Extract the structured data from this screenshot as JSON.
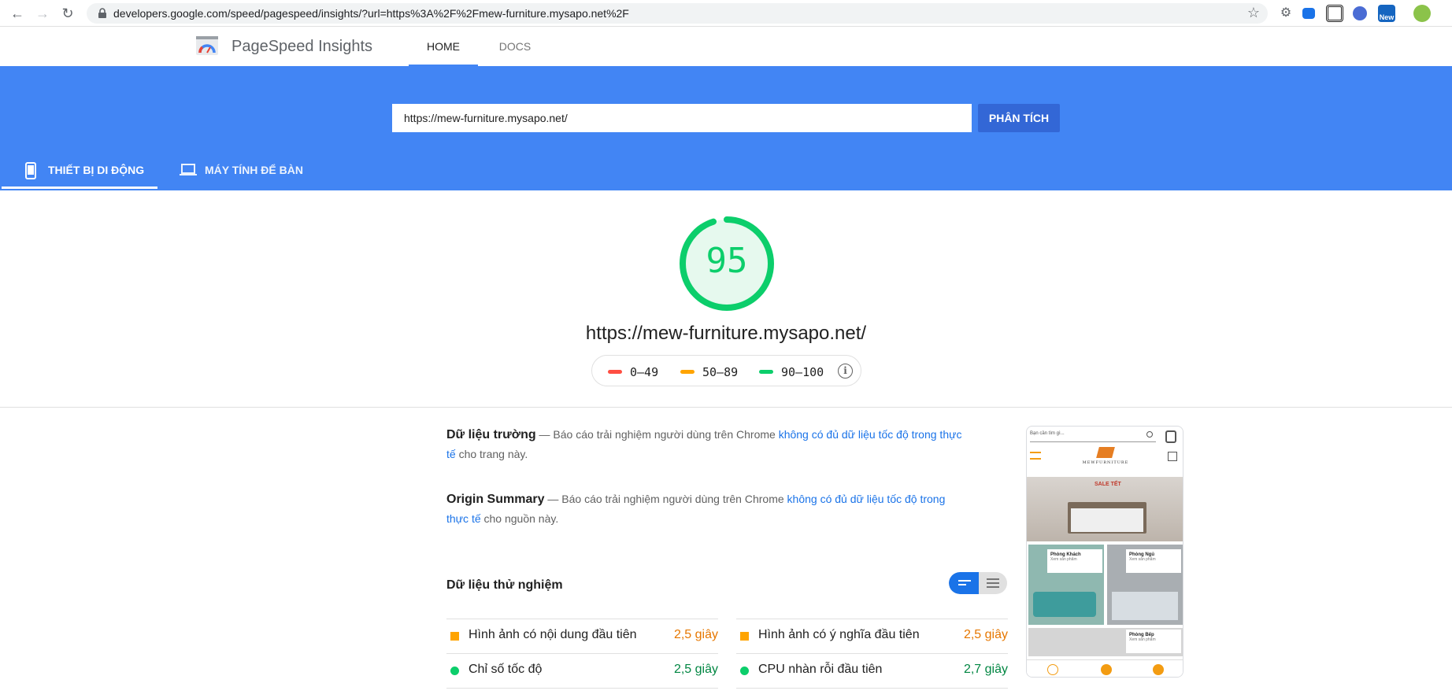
{
  "browser": {
    "url": "developers.google.com/speed/pagespeed/insights/?url=https%3A%2F%2Fmew-furniture.mysapo.net%2F",
    "extension_badge": "New"
  },
  "header": {
    "title": "PageSpeed Insights",
    "tabs": [
      {
        "label": "HOME"
      },
      {
        "label": "DOCS"
      }
    ]
  },
  "search": {
    "value": "https://mew-furniture.mysapo.net/",
    "button": "PHÂN TÍCH"
  },
  "device_tabs": [
    {
      "label": "THIẾT BỊ DI ĐỘNG",
      "active": true
    },
    {
      "label": "MÁY TÍNH ĐỂ BÀN",
      "active": false
    }
  ],
  "score": {
    "value": "95",
    "fraction": 0.95,
    "color": "#0cce6b"
  },
  "tested_url": "https://mew-furniture.mysapo.net/",
  "legend": [
    {
      "label": "0–49",
      "color": "#ff4e42"
    },
    {
      "label": "50–89",
      "color": "#ffa400"
    },
    {
      "label": "90–100",
      "color": "#0cce6b"
    }
  ],
  "field_data": {
    "title": "Dữ liệu trường",
    "text_before": " — Báo cáo trải nghiệm người dùng trên Chrome ",
    "link": "không có đủ dữ liệu tốc độ trong thực tế",
    "text_after": " cho trang này."
  },
  "origin_summary": {
    "title": "Origin Summary",
    "text_before": " — Báo cáo trải nghiệm người dùng trên Chrome ",
    "link": "không có đủ dữ liệu tốc độ trong thực tế",
    "text_after": " cho nguồn này."
  },
  "lab_data": {
    "title": "Dữ liệu thử nghiệm",
    "metrics": [
      {
        "label": "Hình ảnh có nội dung đầu tiên",
        "value": "2,5 giây",
        "status": "average"
      },
      {
        "label": "Hình ảnh có ý nghĩa đầu tiên",
        "value": "2,5 giây",
        "status": "average"
      },
      {
        "label": "Chỉ số tốc độ",
        "value": "2,5 giây",
        "status": "pass"
      },
      {
        "label": "CPU nhàn rỗi đầu tiên",
        "value": "2,7 giây",
        "status": "pass"
      }
    ]
  },
  "colors": {
    "average": "#e67700",
    "average_icon": "#ffa400",
    "pass": "#018642",
    "pass_icon": "#0cce6b",
    "brand_blue": "#4285f4"
  },
  "preview": {
    "search_placeholder": "Bạn cần tìm gì...",
    "brand": "MEWFURNITURE",
    "sale": "SALE TẾT",
    "rooms": [
      {
        "name": "Phòng Khách",
        "sub": "Xem sản phẩm"
      },
      {
        "name": "Phòng Ngủ",
        "sub": "Xem sản phẩm"
      },
      {
        "name": "Phòng Bếp",
        "sub": "Xem sản phẩm"
      }
    ]
  }
}
